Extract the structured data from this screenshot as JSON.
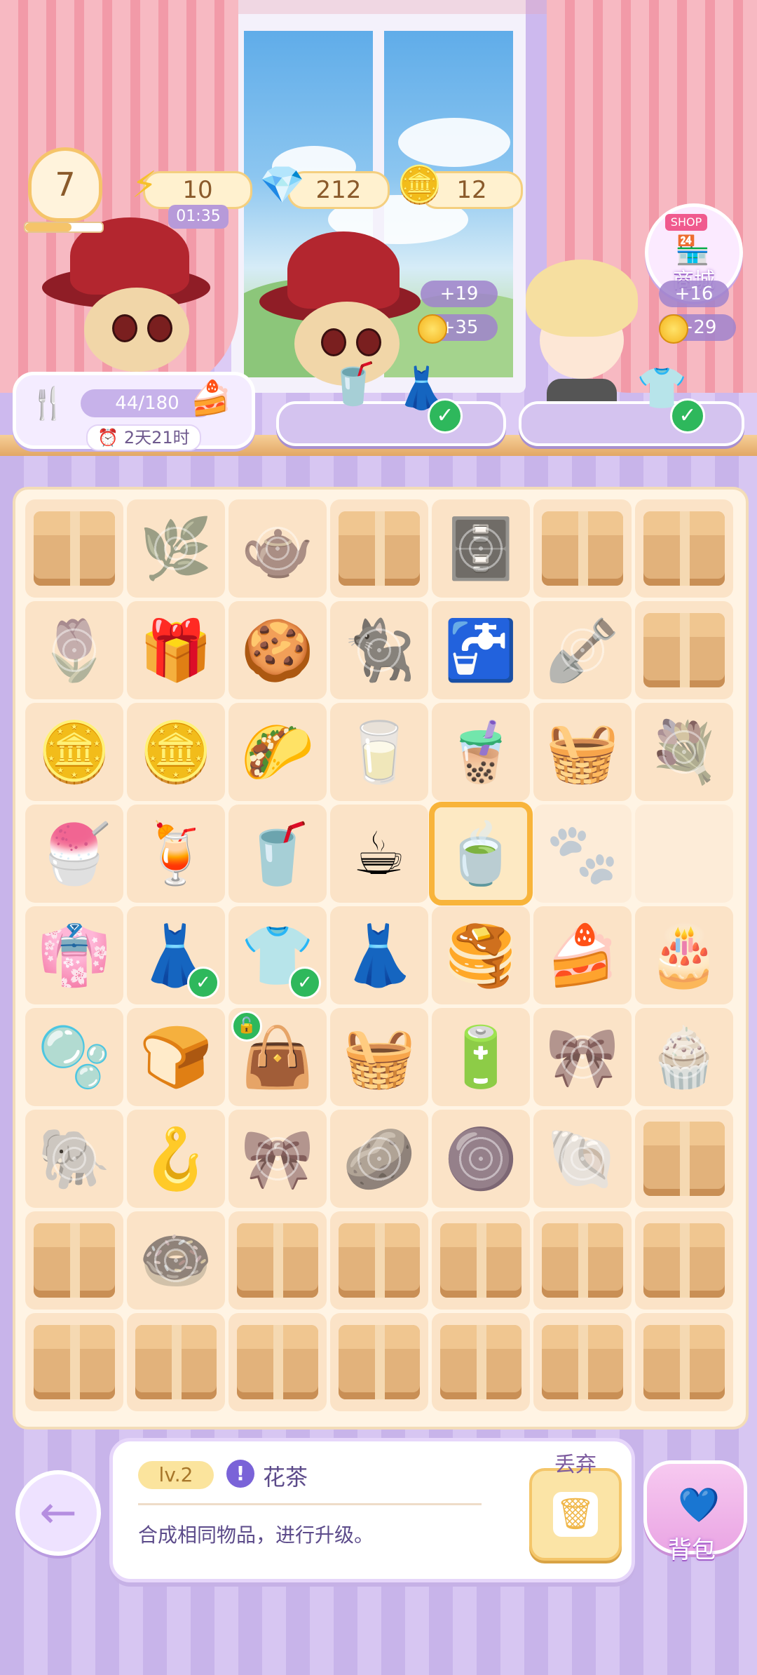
{
  "hud": {
    "level": "7",
    "xp_progress": 0.6,
    "energy": {
      "value": "10",
      "timer": "01:35",
      "icon": "lightning-icon"
    },
    "gems": {
      "value": "212",
      "icon": "gem-icon"
    },
    "coins": {
      "value": "12",
      "icon": "coin-icon"
    }
  },
  "orders": [
    {
      "reward_hearts": "+19",
      "reward_coins": "+35",
      "items": [
        "iced-latte",
        "pink-dress"
      ]
    },
    {
      "reward_hearts": "+16",
      "reward_coins": "+29",
      "items": [
        "green-outfit"
      ]
    }
  ],
  "event": {
    "progress": "44/180",
    "time_left": "2天21时"
  },
  "shop": {
    "sign": "SHOP",
    "label": "商城"
  },
  "board": {
    "cells": [
      {
        "icon": "📦",
        "kind": "box"
      },
      {
        "icon": "🌿",
        "kind": "cobweb"
      },
      {
        "icon": "🫖",
        "kind": "cobweb"
      },
      {
        "icon": "📦",
        "kind": "box"
      },
      {
        "icon": "🗄️",
        "kind": "cobweb"
      },
      {
        "icon": "📦",
        "kind": "box"
      },
      {
        "icon": "📦",
        "kind": "box"
      },
      {
        "icon": "🌷",
        "kind": "cobweb"
      },
      {
        "icon": "🎁",
        "kind": "item"
      },
      {
        "icon": "🍪",
        "kind": "item"
      },
      {
        "icon": "🐈‍⬛",
        "kind": "cobweb"
      },
      {
        "icon": "🚰",
        "kind": "item"
      },
      {
        "icon": "🪏",
        "kind": "cobweb"
      },
      {
        "icon": "📦",
        "kind": "box"
      },
      {
        "icon": "🪙",
        "kind": "item"
      },
      {
        "icon": "🪙",
        "kind": "item"
      },
      {
        "icon": "🌮",
        "kind": "item"
      },
      {
        "icon": "🥛",
        "kind": "item"
      },
      {
        "icon": "🧋",
        "kind": "item"
      },
      {
        "icon": "🧺",
        "kind": "item"
      },
      {
        "icon": "💐",
        "kind": "cobweb"
      },
      {
        "icon": "🍧",
        "kind": "item"
      },
      {
        "icon": "🍹",
        "kind": "item"
      },
      {
        "icon": "🥤",
        "kind": "item"
      },
      {
        "icon": "☕",
        "kind": "item"
      },
      {
        "icon": "🍵",
        "kind": "selected"
      },
      {
        "icon": "🐾",
        "kind": "empty"
      },
      {
        "icon": "",
        "kind": "empty"
      },
      {
        "icon": "👘",
        "kind": "item"
      },
      {
        "icon": "👗",
        "kind": "item",
        "check": true
      },
      {
        "icon": "👕",
        "kind": "item",
        "check": true
      },
      {
        "icon": "👗",
        "kind": "item"
      },
      {
        "icon": "🥞",
        "kind": "item"
      },
      {
        "icon": "🍰",
        "kind": "item"
      },
      {
        "icon": "🎂",
        "kind": "item"
      },
      {
        "icon": "🫧",
        "kind": "item"
      },
      {
        "icon": "🍞",
        "kind": "item"
      },
      {
        "icon": "👜",
        "kind": "item",
        "lock": true
      },
      {
        "icon": "🧺",
        "kind": "item"
      },
      {
        "icon": "🔋",
        "kind": "item"
      },
      {
        "icon": "🎀",
        "kind": "cobweb"
      },
      {
        "icon": "🧁",
        "kind": "cobweb"
      },
      {
        "icon": "🐘",
        "kind": "cobweb"
      },
      {
        "icon": "🪝",
        "kind": "item"
      },
      {
        "icon": "🎀",
        "kind": "cobweb"
      },
      {
        "icon": "🥔",
        "kind": "cobweb"
      },
      {
        "icon": "🟣",
        "kind": "cobweb"
      },
      {
        "icon": "🐚",
        "kind": "cobweb"
      },
      {
        "icon": "📦",
        "kind": "box"
      },
      {
        "icon": "📦",
        "kind": "box"
      },
      {
        "icon": "🍩",
        "kind": "cobweb"
      },
      {
        "icon": "📦",
        "kind": "box"
      },
      {
        "icon": "📦",
        "kind": "box"
      },
      {
        "icon": "📦",
        "kind": "box"
      },
      {
        "icon": "📦",
        "kind": "box"
      },
      {
        "icon": "📦",
        "kind": "box"
      },
      {
        "icon": "📦",
        "kind": "box"
      },
      {
        "icon": "📦",
        "kind": "box"
      },
      {
        "icon": "📦",
        "kind": "box"
      },
      {
        "icon": "📦",
        "kind": "box"
      },
      {
        "icon": "📦",
        "kind": "box"
      },
      {
        "icon": "📦",
        "kind": "box"
      },
      {
        "icon": "📦",
        "kind": "box"
      }
    ]
  },
  "info_panel": {
    "level": "lv.2",
    "item_name": "花茶",
    "description": "合成相同物品，进行升级。",
    "discard_label": "丢弃"
  },
  "bag": {
    "label": "背包"
  }
}
